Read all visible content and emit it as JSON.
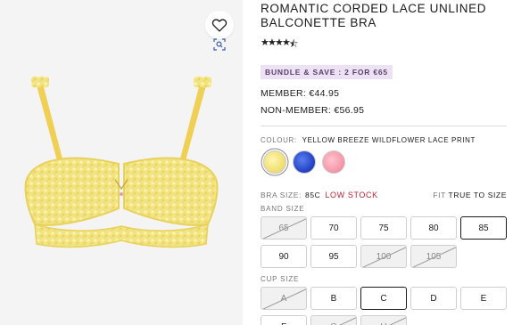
{
  "product": {
    "title": "ROMANTIC CORDED LACE UNLINED BALCONETTE BRA",
    "rating_stars": "4.5",
    "bundle_badge": "BUNDLE & SAVE : 2 FOR €65",
    "member_price": "MEMBER: €44.95",
    "non_member_price": "NON-MEMBER: €56.95"
  },
  "colour": {
    "label": "COLOUR:",
    "value": "YELLOW BREEZE WILDFLOWER LACE PRINT",
    "swatches": [
      {
        "name": "yellow",
        "selected": true,
        "color": "#f1e27a"
      },
      {
        "name": "blue",
        "selected": false,
        "color": "#2846c8"
      },
      {
        "name": "pink",
        "selected": false,
        "color": "#f59aaa"
      }
    ]
  },
  "size": {
    "label": "BRA SIZE:",
    "value": "85C",
    "stock": "LOW STOCK",
    "fit_label": "FIT",
    "fit_value": "TRUE TO SIZE",
    "band_label": "BAND SIZE",
    "cup_label": "CUP SIZE",
    "band_options": [
      {
        "label": "65",
        "available": false,
        "selected": false
      },
      {
        "label": "70",
        "available": true,
        "selected": false
      },
      {
        "label": "75",
        "available": true,
        "selected": false
      },
      {
        "label": "80",
        "available": true,
        "selected": false
      },
      {
        "label": "85",
        "available": true,
        "selected": true
      },
      {
        "label": "90",
        "available": true,
        "selected": false
      },
      {
        "label": "95",
        "available": true,
        "selected": false
      },
      {
        "label": "100",
        "available": false,
        "selected": false
      },
      {
        "label": "105",
        "available": false,
        "selected": false
      }
    ],
    "cup_options": [
      {
        "label": "A",
        "available": false,
        "selected": false
      },
      {
        "label": "B",
        "available": true,
        "selected": false
      },
      {
        "label": "C",
        "available": true,
        "selected": true
      },
      {
        "label": "D",
        "available": true,
        "selected": false
      },
      {
        "label": "E",
        "available": true,
        "selected": false
      },
      {
        "label": "F",
        "available": true,
        "selected": false
      },
      {
        "label": "G",
        "available": false,
        "selected": false
      },
      {
        "label": "H",
        "available": false,
        "selected": false
      }
    ]
  },
  "icons": {
    "favorite": "heart-icon",
    "visual_search": "lens-icon"
  },
  "colors": {
    "low_stock": "#b3243a",
    "bundle_bg": "#ece2f4"
  }
}
